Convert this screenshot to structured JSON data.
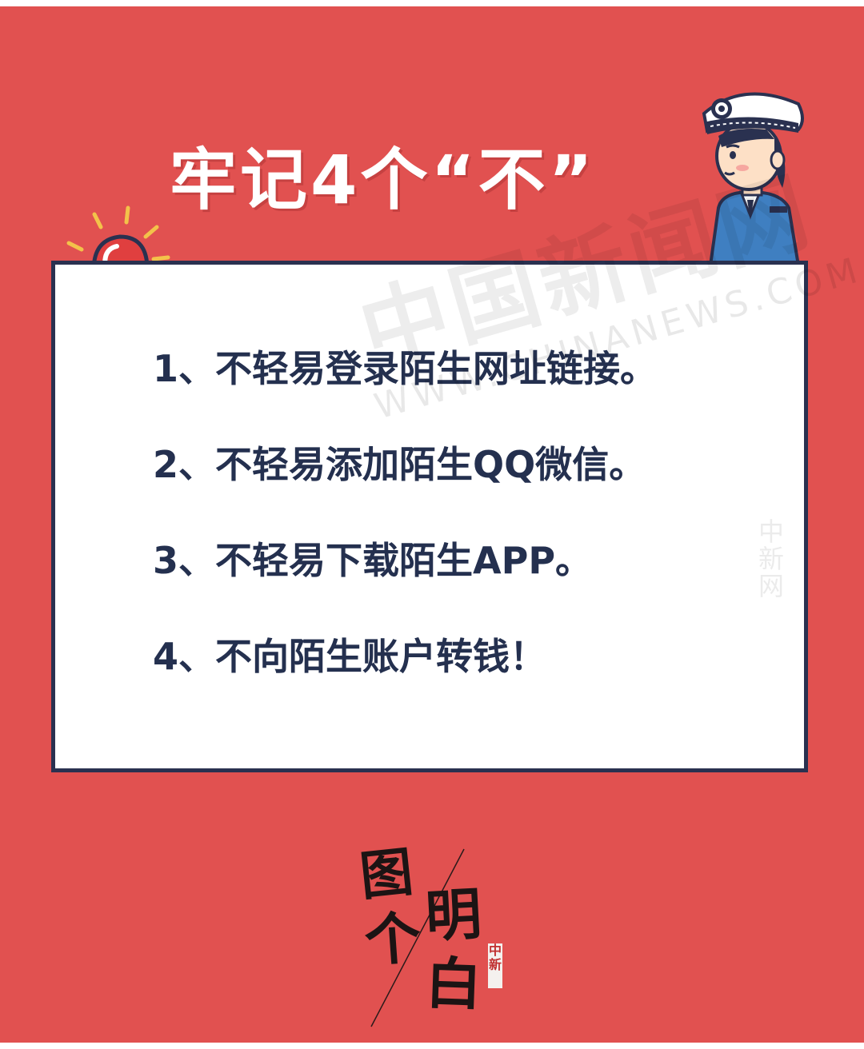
{
  "poster": {
    "title": "牢记4个“不”",
    "rules": [
      "1、不轻易登录陌生网址链接。",
      "2、不轻易添加陌生QQ微信。",
      "3、不轻易下载陌生APP。",
      "4、不向陌生账户转钱！"
    ],
    "colors": {
      "background": "#e15150",
      "card": "#ffffff",
      "card_border": "#2a3150",
      "rule_text": "#24304f",
      "title_text": "#ffffff"
    }
  },
  "watermark": {
    "chinese": "中国新闻网",
    "url": "WWW.CHINANEWS.COM",
    "side": "中新网"
  },
  "logo": {
    "chars": [
      "图",
      "个",
      "明",
      "白"
    ],
    "stamp": "中新"
  },
  "icons": {
    "siren": "siren-icon",
    "officer": "police-officer-illustration"
  }
}
